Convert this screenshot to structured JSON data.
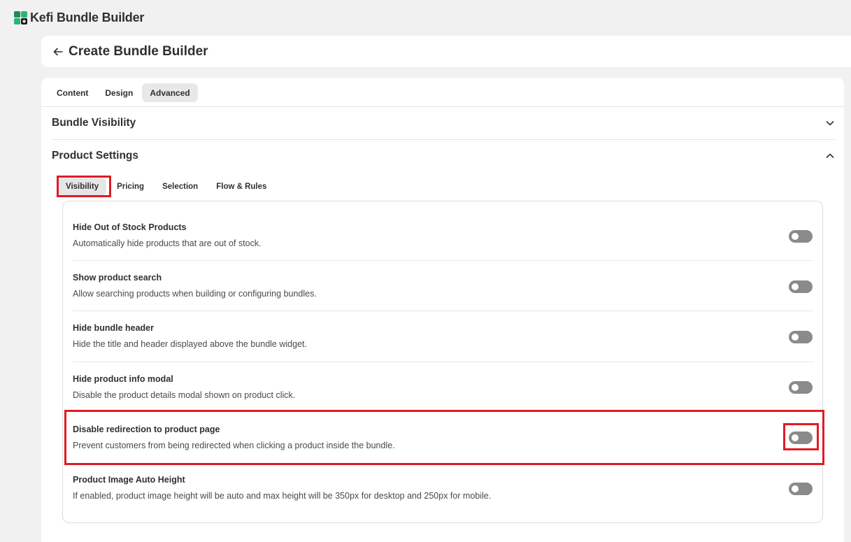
{
  "app": {
    "title": "Kefi Bundle Builder",
    "logo_icon": "app-logo-icon"
  },
  "header": {
    "title": "Create Bundle Builder",
    "back_icon": "arrow-left-icon"
  },
  "tabs": [
    {
      "label": "Content",
      "active": false
    },
    {
      "label": "Design",
      "active": false
    },
    {
      "label": "Advanced",
      "active": true
    }
  ],
  "sections": {
    "bundle_visibility": {
      "title": "Bundle Visibility",
      "expanded": false
    },
    "product_settings": {
      "title": "Product Settings",
      "expanded": true
    }
  },
  "sub_tabs": [
    {
      "label": "Visibility",
      "active": true
    },
    {
      "label": "Pricing",
      "active": false
    },
    {
      "label": "Selection",
      "active": false
    },
    {
      "label": "Flow & Rules",
      "active": false
    }
  ],
  "settings": [
    {
      "title": "Hide Out of Stock Products",
      "description": "Automatically hide products that are out of stock.",
      "enabled": false
    },
    {
      "title": "Show product search",
      "description": "Allow searching products when building or configuring bundles.",
      "enabled": false
    },
    {
      "title": "Hide bundle header",
      "description": "Hide the title and header displayed above the bundle widget.",
      "enabled": false
    },
    {
      "title": "Hide product info modal",
      "description": "Disable the product details modal shown on product click.",
      "enabled": false
    },
    {
      "title": "Disable redirection to product page",
      "description": "Prevent customers from being redirected when clicking a product inside the bundle.",
      "enabled": false
    },
    {
      "title": "Product Image Auto Height",
      "description": "If enabled, product image height will be auto and max height will be 350px for desktop and 250px for mobile.",
      "enabled": false
    }
  ],
  "colors": {
    "highlight": "#e01b24",
    "toggle_off": "#8a8a8a",
    "page_bg": "#f1f1f1"
  }
}
